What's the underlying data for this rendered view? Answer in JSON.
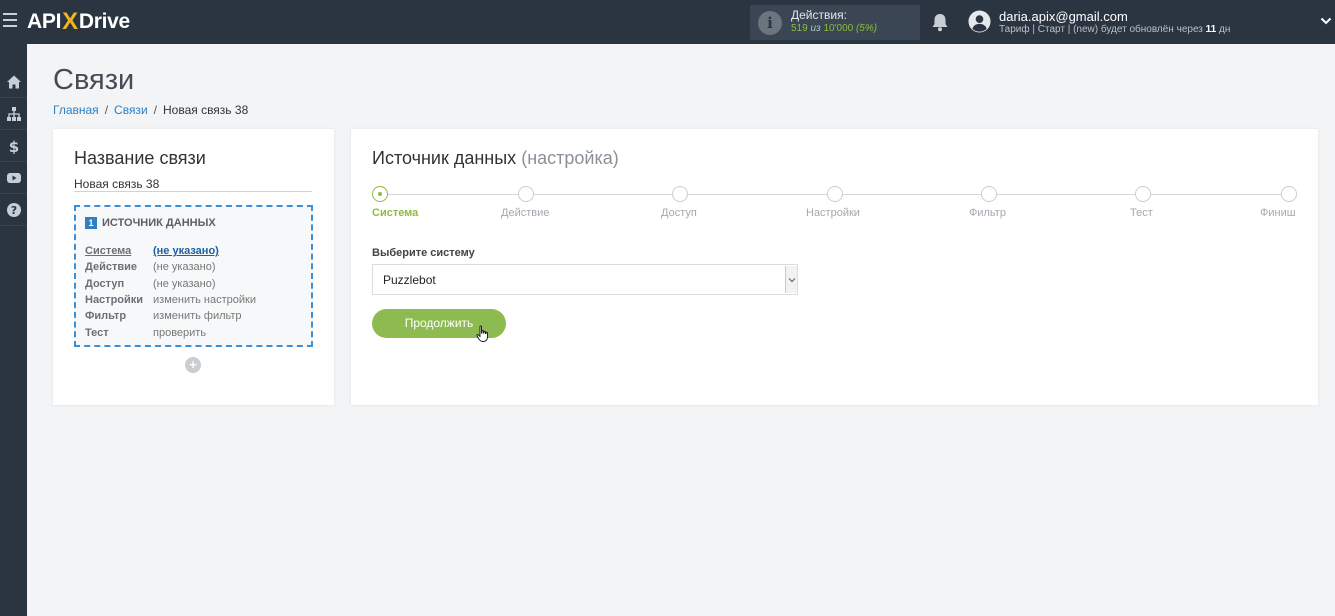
{
  "app": {
    "logo_left": "API",
    "logo_x": "X",
    "logo_right": "Drive"
  },
  "topbar": {
    "actions_label": "Действия:",
    "actions_used": "519",
    "actions_of": "из",
    "actions_total": "10'000",
    "actions_pct": "(5%)",
    "user_email": "daria.apix@gmail.com",
    "plan_text": "Тариф | Старт | (new) будет обновлён через",
    "plan_days": "11",
    "plan_days_unit": "дн"
  },
  "sidebar": {
    "items": [
      "home-icon",
      "sitemap-icon",
      "dollar-icon",
      "youtube-icon",
      "help-icon"
    ]
  },
  "page": {
    "title": "Связи",
    "breadcrumb": [
      "Главная",
      "Связи",
      "Новая связь 38"
    ]
  },
  "left_card": {
    "title": "Название связи",
    "name_value": "Новая связь 38",
    "source_number": "1",
    "source_title": "ИСТОЧНИК ДАННЫХ",
    "rows": [
      {
        "key": "Система",
        "value": "(не указано)"
      },
      {
        "key": "Действие",
        "value": "(не указано)"
      },
      {
        "key": "Доступ",
        "value": "(не указано)"
      },
      {
        "key": "Настройки",
        "value": "изменить настройки"
      },
      {
        "key": "Фильтр",
        "value": "изменить фильтр"
      },
      {
        "key": "Тест",
        "value": "проверить"
      }
    ],
    "add_label": "+"
  },
  "right_card": {
    "title": "Источник данных",
    "title_sub": "(настройка)",
    "steps": [
      "Система",
      "Действие",
      "Доступ",
      "Настройки",
      "Фильтр",
      "Тест",
      "Финиш"
    ],
    "active_step": 0,
    "select_label": "Выберите систему",
    "select_value": "Puzzlebot",
    "continue_label": "Продолжить"
  },
  "colors": {
    "accent_green": "#8dbb52",
    "link_blue": "#2f7fc1",
    "topbar": "#2b3542"
  }
}
